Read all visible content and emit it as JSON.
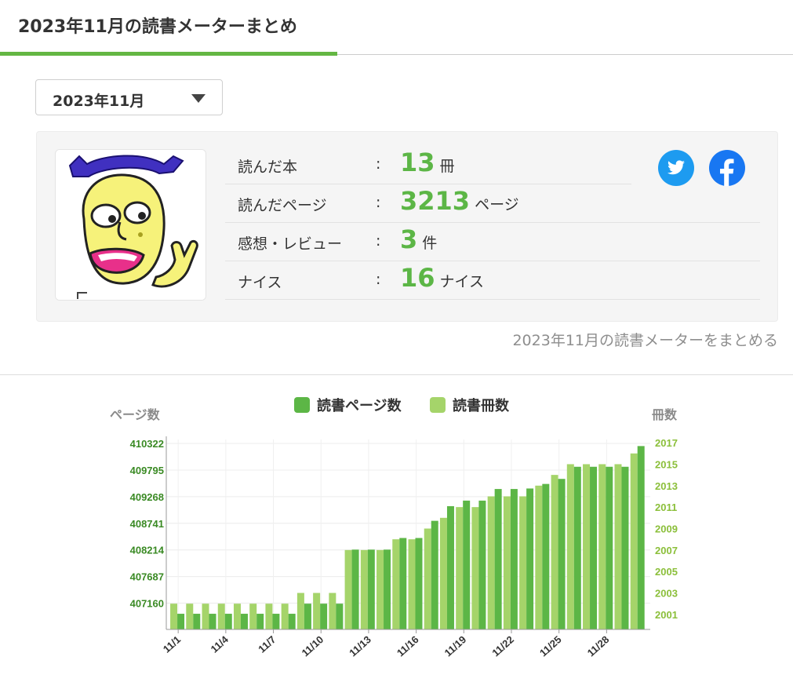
{
  "header": {
    "title": "2023年11月の読書メーターまとめ"
  },
  "month_select": {
    "selected": "2023年11月"
  },
  "stats": [
    {
      "label": "読んだ本",
      "colon": ":",
      "value": "13",
      "unit": "冊"
    },
    {
      "label": "読んだページ",
      "colon": ":",
      "value": "3213",
      "unit": "ページ"
    },
    {
      "label": "感想・レビュー",
      "colon": ":",
      "value": "3",
      "unit": "件"
    },
    {
      "label": "ナイス",
      "colon": ":",
      "value": "16",
      "unit": "ナイス"
    }
  ],
  "share": {
    "twitter_icon": "twitter-icon",
    "facebook_icon": "facebook-icon",
    "summary_link": "2023年11月の読書メーターをまとめる"
  },
  "colors": {
    "accent": "#64b743",
    "pages_series": "#5cb646",
    "books_series": "#a5d46a"
  },
  "chart_data": {
    "type": "bar",
    "ylabel_left": "ページ数",
    "ylabel_right": "冊数",
    "x": [
      "11/1",
      "11/2",
      "11/3",
      "11/4",
      "11/5",
      "11/6",
      "11/7",
      "11/8",
      "11/9",
      "11/10",
      "11/11",
      "11/12",
      "11/13",
      "11/14",
      "11/15",
      "11/16",
      "11/17",
      "11/18",
      "11/19",
      "11/20",
      "11/21",
      "11/22",
      "11/23",
      "11/24",
      "11/25",
      "11/26",
      "11/27",
      "11/28",
      "11/29",
      "11/30"
    ],
    "xtick_labels": [
      "11/1",
      "11/4",
      "11/7",
      "11/10",
      "11/13",
      "11/16",
      "11/19",
      "11/22",
      "11/25",
      "11/28"
    ],
    "xtick_indices": [
      0,
      3,
      6,
      9,
      12,
      15,
      18,
      21,
      24,
      27
    ],
    "ylim_left": [
      406640,
      410400
    ],
    "yticks_left": [
      407160,
      407687,
      408214,
      408741,
      409268,
      409795,
      410322
    ],
    "ylim_right": [
      1999.6,
      2017.3
    ],
    "yticks_right": [
      2001,
      2003,
      2005,
      2007,
      2009,
      2011,
      2013,
      2015,
      2017
    ],
    "series": [
      {
        "name": "読書ページ数",
        "axis": "left",
        "values": [
          406950,
          406950,
          406950,
          406950,
          406950,
          406950,
          406950,
          406950,
          407150,
          407150,
          407150,
          408220,
          408220,
          408220,
          408450,
          408450,
          408790,
          409080,
          409190,
          409190,
          409420,
          409420,
          409430,
          409520,
          409620,
          409860,
          409860,
          409860,
          409860,
          410270
        ]
      },
      {
        "name": "読書冊数",
        "axis": "right",
        "values": [
          2002,
          2002,
          2002,
          2002,
          2002,
          2002,
          2002,
          2002,
          2003,
          2003,
          2003,
          2007,
          2007,
          2007,
          2008,
          2008,
          2009,
          2010,
          2011,
          2011,
          2012,
          2012,
          2012,
          2013,
          2014,
          2015,
          2015,
          2015,
          2015,
          2016
        ]
      }
    ]
  }
}
